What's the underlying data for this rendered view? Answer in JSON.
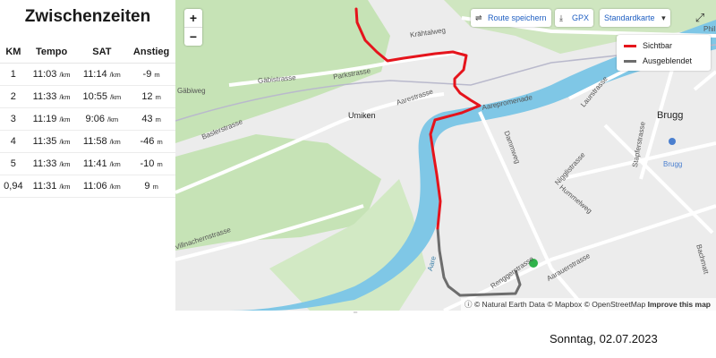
{
  "splits": {
    "title": "Zwischenzeiten",
    "headers": [
      "KM",
      "Tempo",
      "SAT",
      "Anstieg"
    ],
    "rows": [
      {
        "km": "1",
        "tempo": "11:03",
        "tempo_unit": "/km",
        "sat": "11:14",
        "sat_unit": "/km",
        "anstieg": "-9",
        "anstieg_unit": "m"
      },
      {
        "km": "2",
        "tempo": "11:33",
        "tempo_unit": "/km",
        "sat": "10:55",
        "sat_unit": "/km",
        "anstieg": "12",
        "anstieg_unit": "m"
      },
      {
        "km": "3",
        "tempo": "11:19",
        "tempo_unit": "/km",
        "sat": "9:06",
        "sat_unit": "/km",
        "anstieg": "43",
        "anstieg_unit": "m"
      },
      {
        "km": "4",
        "tempo": "11:35",
        "tempo_unit": "/km",
        "sat": "11:58",
        "sat_unit": "/km",
        "anstieg": "-46",
        "anstieg_unit": "m"
      },
      {
        "km": "5",
        "tempo": "11:33",
        "tempo_unit": "/km",
        "sat": "11:41",
        "sat_unit": "/km",
        "anstieg": "-10",
        "anstieg_unit": "m"
      },
      {
        "km": "0,94",
        "tempo": "11:31",
        "tempo_unit": "/km",
        "sat": "11:06",
        "sat_unit": "/km",
        "anstieg": "9",
        "anstieg_unit": "m"
      }
    ]
  },
  "map": {
    "zoom_in": "+",
    "zoom_out": "−",
    "route_save": "Route speichern",
    "gpx": "GPX",
    "map_style": "Standardkarte",
    "legend": {
      "visible": "Sichtbar",
      "hidden": "Ausgeblendet",
      "visible_color": "#e5141c",
      "hidden_color": "#6d6d6d"
    },
    "labels": {
      "kraehtalweg": "Krähtalweg",
      "parkstrasse": "Parkstrasse",
      "gaebistrasse": "Gäbistrasse",
      "gaebiweg": "Gäbiweg",
      "aarestrasse": "Aarestrasse",
      "umiken": "Umiken",
      "baslerstrasse": "Baslerstrasse",
      "aarepromenade": "Aarepromenade",
      "laurstrasse": "Laurstrasse",
      "brugg": "Brugg",
      "brugg_station": "Brugg",
      "dammweg": "Dammweg",
      "nigglistrasse": "Nigglistrasse",
      "stapferstrasse": "Stapferstrasse",
      "hummelweg": "Hummelweg",
      "villnachernstrasse": "Villnachernstrasse",
      "renggerstrasse": "Renggerstrasse",
      "aarauerstrasse": "Aarauerstrasse",
      "aare": "Aare",
      "bachmatt": "Bachmatt",
      "philipp": "Phil"
    },
    "attribution": {
      "natural_earth": "© Natural Earth Data",
      "mapbox": "© Mapbox",
      "osm": "© OpenStreetMap",
      "improve": "Improve this map"
    }
  },
  "footer": {
    "date": "Sonntag, 02.07.2023"
  },
  "colors": {
    "route_visible": "#e5141c",
    "route_hidden": "#6d6d6d",
    "water": "#7fc7e6",
    "green": "#c6e3b6",
    "link": "#1f5fc2",
    "end_marker": "#2fb24a"
  }
}
